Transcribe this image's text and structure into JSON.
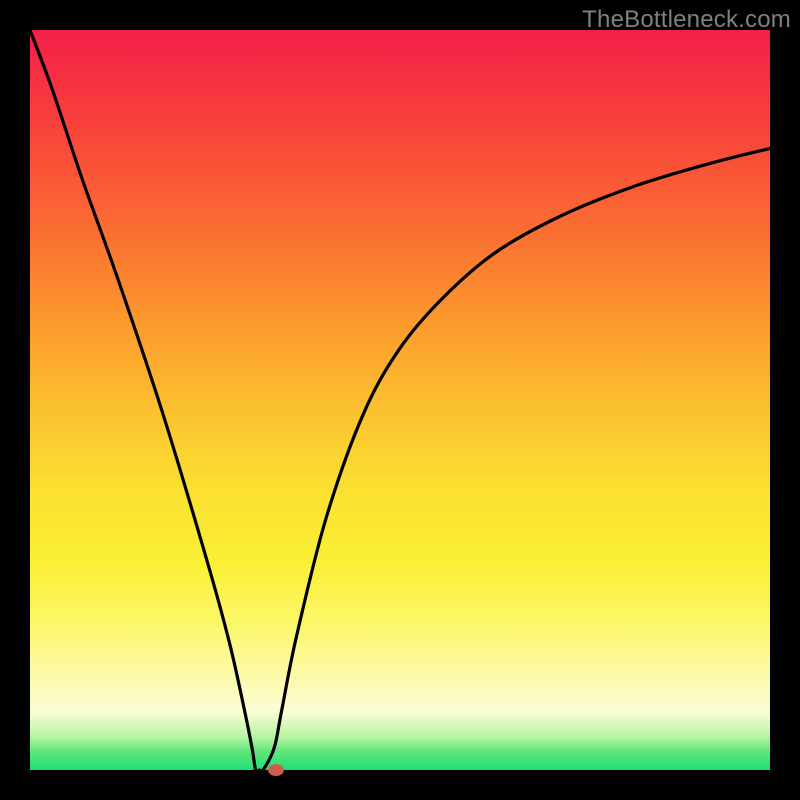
{
  "watermark": "TheBottleneck.com",
  "chart_data": {
    "type": "line",
    "title": "",
    "xlabel": "",
    "ylabel": "",
    "xlim": [
      0,
      100
    ],
    "ylim": [
      0,
      100
    ],
    "grid": false,
    "legend": false,
    "series": [
      {
        "name": "bottleneck-curve",
        "x": [
          0,
          3,
          7,
          12,
          18,
          24,
          27,
          29,
          30,
          30.5,
          31,
          31.5,
          33,
          34,
          36,
          40,
          45,
          50,
          56,
          63,
          72,
          82,
          92,
          100
        ],
        "y": [
          100,
          92,
          80,
          66,
          48,
          28,
          17,
          8,
          3,
          0,
          0,
          0,
          3,
          8,
          18,
          34,
          48,
          57,
          64,
          70,
          75,
          79,
          82,
          84
        ]
      }
    ],
    "marker": {
      "x": 33.3,
      "y": 0,
      "color": "#cf5d4e"
    },
    "gradient_stops": [
      {
        "pos": 0,
        "color": "#f31f49"
      },
      {
        "pos": 0.5,
        "color": "#fbc330"
      },
      {
        "pos": 0.8,
        "color": "#fcf767"
      },
      {
        "pos": 1.0,
        "color": "#1fdf73"
      }
    ]
  }
}
